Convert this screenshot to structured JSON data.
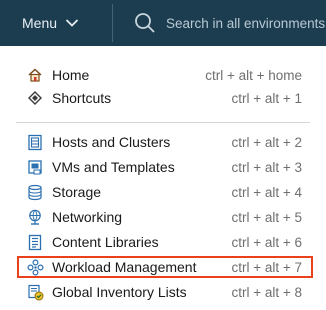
{
  "topbar": {
    "menu_label": "Menu",
    "search_placeholder": "Search in all environments"
  },
  "menu": {
    "group1": [
      {
        "label": "Home",
        "shortcut": "ctrl + alt + home",
        "icon": "home-icon"
      },
      {
        "label": "Shortcuts",
        "shortcut": "ctrl + alt + 1",
        "icon": "shortcuts-icon"
      }
    ],
    "group2": [
      {
        "label": "Hosts and Clusters",
        "shortcut": "ctrl + alt + 2",
        "icon": "hosts-clusters-icon"
      },
      {
        "label": "VMs and Templates",
        "shortcut": "ctrl + alt + 3",
        "icon": "vms-templates-icon"
      },
      {
        "label": "Storage",
        "shortcut": "ctrl + alt + 4",
        "icon": "storage-icon"
      },
      {
        "label": "Networking",
        "shortcut": "ctrl + alt + 5",
        "icon": "networking-icon"
      },
      {
        "label": "Content Libraries",
        "shortcut": "ctrl + alt + 6",
        "icon": "content-libraries-icon"
      },
      {
        "label": "Workload Management",
        "shortcut": "ctrl + alt + 7",
        "icon": "workload-management-icon"
      },
      {
        "label": "Global Inventory Lists",
        "shortcut": "ctrl + alt + 8",
        "icon": "global-inventory-icon"
      }
    ],
    "highlighted_item": "Workload Management"
  },
  "colors": {
    "topbar_bg": "#1c3d50",
    "highlight_border": "#e8411c",
    "icon_blue": "#2a6fb0"
  }
}
